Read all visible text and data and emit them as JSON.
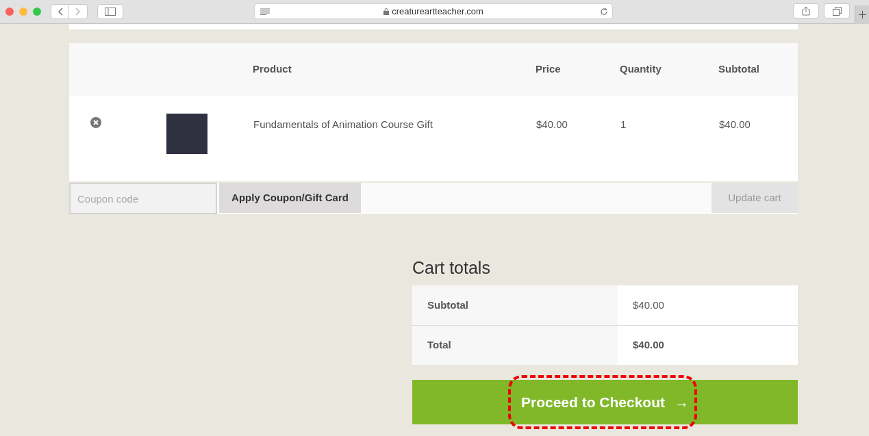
{
  "browser": {
    "url": "creatureartteacher.com"
  },
  "cart": {
    "columns": [
      "Product",
      "Price",
      "Quantity",
      "Subtotal"
    ],
    "rows": [
      {
        "product": "Fundamentals of Animation Course Gift",
        "price": "$40.00",
        "quantity": "1",
        "subtotal": "$40.00"
      }
    ],
    "coupon": {
      "placeholder": "Coupon code"
    },
    "apply_button": "Apply Coupon/Gift Card",
    "update_button": "Update cart"
  },
  "cart_totals": {
    "title": "Cart totals",
    "rows": [
      {
        "label": "Subtotal",
        "value": "$40.00",
        "kind": "plain"
      },
      {
        "label": "Total",
        "value": "$40.00",
        "kind": "strong"
      }
    ],
    "checkout_button": {
      "label": "Proceed to Checkout",
      "arrow": "→",
      "highlighted": true
    }
  }
}
